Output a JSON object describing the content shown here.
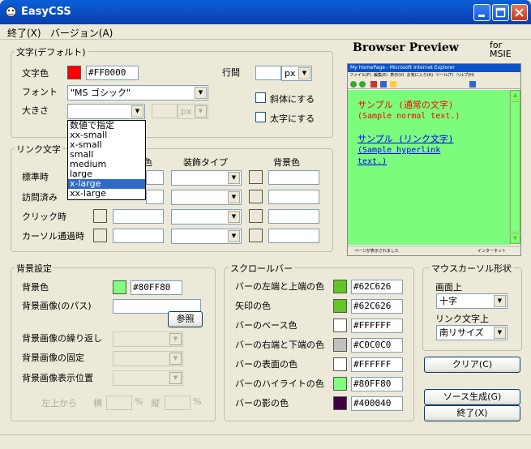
{
  "window": {
    "title": "EasyCSS"
  },
  "menu": [
    "終了(X)",
    "バージョン(A)"
  ],
  "text_default": {
    "legend": "文字(デフォルト)",
    "color_label": "文字色",
    "color_hex": "#FF0000",
    "color_swatch": "#ff0000",
    "font_label": "フォント",
    "font_value": "\"MS ゴシック\"",
    "size_label": "大きさ",
    "size_value": "",
    "size_unit": "px",
    "line_label": "行間",
    "line_value": "",
    "line_unit": "px",
    "italic_label": "斜体にする",
    "bold_label": "太字にする",
    "size_options": [
      "数値で指定",
      "xx-small",
      "x-small",
      "small",
      "medium",
      "large",
      "x-large",
      "xx-large"
    ],
    "size_selected": "x-large"
  },
  "link_text": {
    "legend": "リンク文字",
    "col_color": "色",
    "col_decoration": "装飾タイプ",
    "col_bg": "背景色",
    "rows": [
      "標準時",
      "訪問済み",
      "クリック時",
      "カーソル通過時"
    ]
  },
  "preview": {
    "title": "Browser Preview",
    "for_label": "for",
    "for_value": "MSIE",
    "ie_title": "My HomePage - Microsoft Internet Explorer",
    "ie_menu": "ファイル(F)  編集(E)  表示(V)  お気に入り(A)  ツール(T)  ヘルプ(H)",
    "ie_status_left": "ページが表示されました",
    "ie_status_right": "インターネット",
    "normal_line1": "サンプル (通常の文字)",
    "normal_line2": "(Sample normal text.)",
    "link_line1": "サンプル (リンク文字)",
    "link_line2": "(Sample hyperlink",
    "link_line3": "text.)"
  },
  "background": {
    "legend": "背景設定",
    "color_label": "背景色",
    "color_hex": "#80FF80",
    "color_swatch": "#80ff80",
    "image_label": "背景画像(のパス)",
    "image_value": "",
    "browse_label": "参照",
    "repeat_label": "背景画像の繰り返し",
    "fixed_label": "背景画像の固定",
    "position_label": "背景画像表示位置",
    "from_topleft": "左上から",
    "horiz": "横",
    "vert": "縦",
    "pct": "%"
  },
  "scrollbar": {
    "legend": "スクロールバー",
    "rows": [
      {
        "label": "バーの左端と上端の色",
        "hex": "#62C626",
        "swatch": "#62c626"
      },
      {
        "label": "矢印の色",
        "hex": "#62C626",
        "swatch": "#62c626"
      },
      {
        "label": "バーのベース色",
        "hex": "#FFFFFF",
        "swatch": "#ffffff"
      },
      {
        "label": "バーの右端と下端の色",
        "hex": "#C0C0C0",
        "swatch": "#c0c0c0"
      },
      {
        "label": "バーの表面の色",
        "hex": "#FFFFFF",
        "swatch": "#ffffff"
      },
      {
        "label": "バーのハイライトの色",
        "hex": "#80FF80",
        "swatch": "#80ff80"
      },
      {
        "label": "バーの影の色",
        "hex": "#400040",
        "swatch": "#400040"
      }
    ]
  },
  "cursor": {
    "legend": "マウスカーソル形状",
    "screen_label": "画面上",
    "screen_value": "十字",
    "link_label": "リンク文字上",
    "link_value": "南リサイズ"
  },
  "buttons": {
    "clear": "クリア(C)",
    "generate": "ソース生成(G)",
    "exit": "終了(X)"
  }
}
